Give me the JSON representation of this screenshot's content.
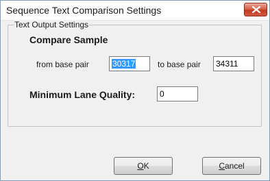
{
  "window": {
    "title": "Sequence Text Comparison Settings",
    "close_icon": "close-icon"
  },
  "group": {
    "legend": "Text Output Settings"
  },
  "compare": {
    "heading": "Compare Sample",
    "from_label": "from base pair",
    "from_value": "30317",
    "to_label": "to base pair",
    "to_value": "34311"
  },
  "quality": {
    "label": "Minimum Lane Quality:",
    "value": "0"
  },
  "buttons": {
    "ok_mnemonic": "O",
    "ok_rest": "K",
    "cancel_mnemonic": "C",
    "cancel_rest": "ancel"
  }
}
